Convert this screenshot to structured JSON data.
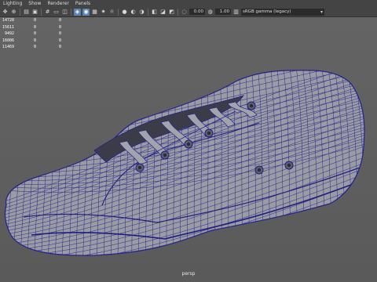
{
  "menubar": {
    "items": [
      "Lighting",
      "Show",
      "Renderer",
      "Panels"
    ]
  },
  "toolbar": {
    "field_a": "0.00",
    "field_b": "1.00",
    "color_space": "sRGB gamma (legacy)"
  },
  "hud": {
    "rows": [
      [
        "14728",
        "0",
        "0"
      ],
      [
        "15611",
        "0",
        "0"
      ],
      [
        "9492",
        "0",
        "0"
      ],
      [
        "16006",
        "0",
        "0"
      ],
      [
        "11469",
        "0",
        "0"
      ]
    ]
  },
  "viewport": {
    "camera": "persp"
  },
  "colors": {
    "wire": "#27288f",
    "mesh_fill": "#9b9ba3",
    "background": "#5d5d5d"
  }
}
